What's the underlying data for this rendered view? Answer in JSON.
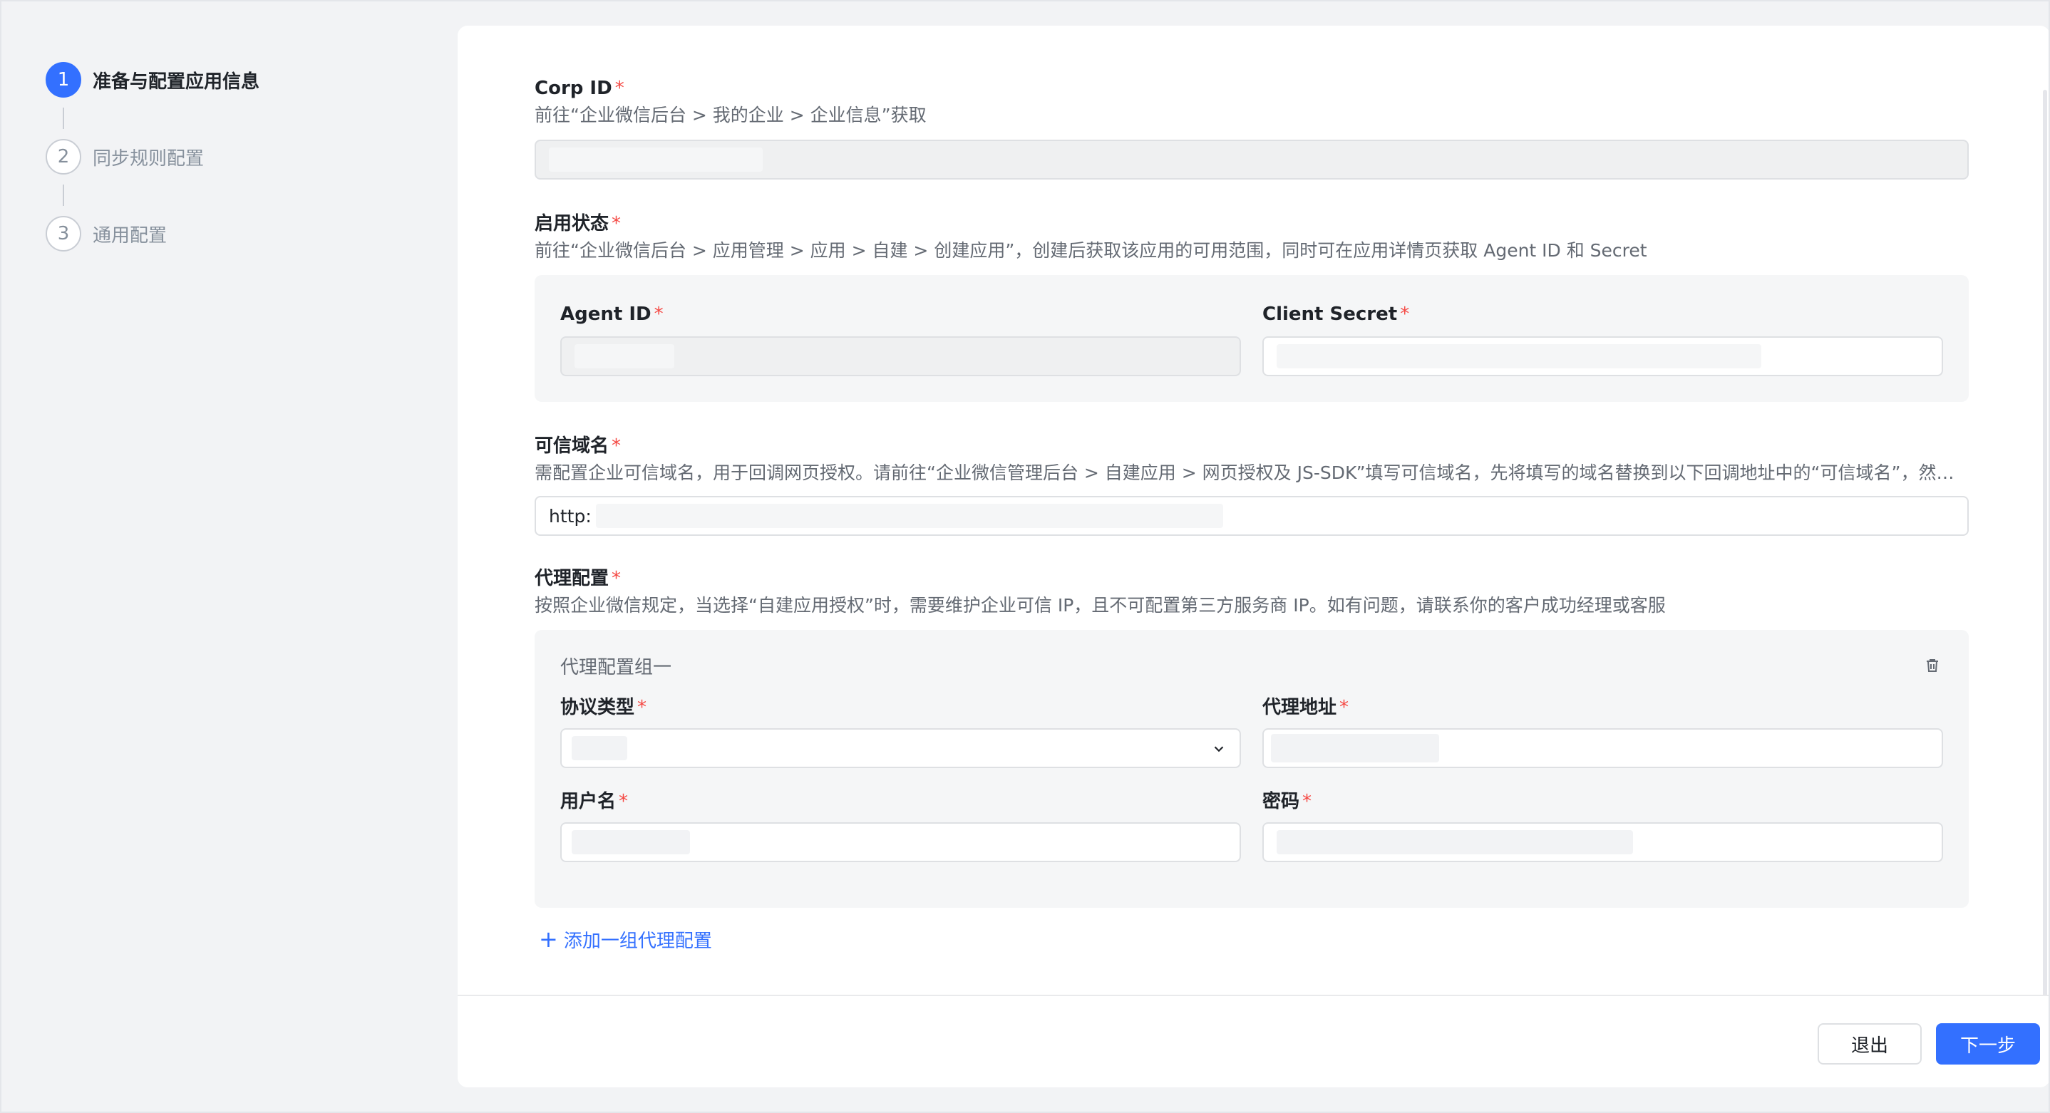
{
  "steps": [
    {
      "num": "1",
      "label": "准备与配置应用信息",
      "active": true
    },
    {
      "num": "2",
      "label": "同步规则配置",
      "active": false
    },
    {
      "num": "3",
      "label": "通用配置",
      "active": false
    }
  ],
  "corp_id": {
    "title": "Corp ID",
    "required": "*",
    "desc": "前往“企业微信后台 > 我的企业 > 企业信息”获取"
  },
  "enable_status": {
    "title": "启用状态",
    "required": "*",
    "desc": "前往“企业微信后台 > 应用管理 > 应用 > 自建 > 创建应用”，创建后获取该应用的可用范围，同时可在应用详情页获取 Agent ID 和 Secret",
    "agent_id_label": "Agent ID",
    "client_secret_label": "Client Secret"
  },
  "trusted_domain": {
    "title": "可信域名",
    "required": "*",
    "desc": "需配置企业可信域名，用于回调网页授权。请前往“企业微信管理后台 > 自建应用 > 网页授权及 JS-SDK”填写可信域名，先将填写的域名替换到以下回调地址中的“可信域名”，然后...",
    "value": "http:"
  },
  "proxy": {
    "title": "代理配置",
    "required": "*",
    "desc": "按照企业微信规定，当选择“自建应用授权”时，需要维护企业可信 IP，且不可配置第三方服务商 IP。如有问题，请联系你的客户成功经理或客服",
    "group_title": "代理配置组一",
    "protocol_label": "协议类型",
    "address_label": "代理地址",
    "username_label": "用户名",
    "password_label": "密码",
    "add_label": "添加一组代理配置"
  },
  "footer": {
    "exit_label": "退出",
    "next_label": "下一步"
  },
  "colors": {
    "accent": "#3370ff",
    "required": "#f54a45"
  }
}
